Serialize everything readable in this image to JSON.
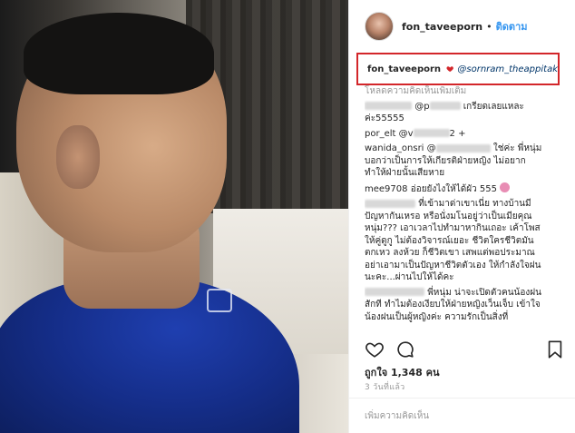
{
  "post": {
    "username": "fon_taveeporn",
    "dot": "•",
    "follow_label": "ติดตาม",
    "caption_mention": "@sornram_theappitak",
    "view_more_comments": "โหลดความคิดเห็นเพิ่มเติม",
    "comments": [
      {
        "handle_shown": "@p",
        "text": "เกรียดเลยแหละ",
        "text2": "ค่ะ55555"
      },
      {
        "handle_shown": "por_elt",
        "text": "@v",
        "text2": "2 +"
      },
      {
        "handle_shown": "wanida_onsri",
        "text": "@",
        "text2": "ใช่ค่ะ พี่หนุ่ม",
        "text3": "บอกว่าเป็นการให้เกียรติฝ่ายหญิง ไม่อยาก",
        "text4": "ทำให้ฝ่ายนั้นเสียหาย"
      },
      {
        "handle_shown": "mee9708",
        "text": "อ่อยยังไงให้ได้ผัว 555"
      },
      {
        "handle_shown": "malikal2443",
        "text": "ที่เข้ามาด่าเขาเนี่ย ทางบ้านมี",
        "text2": "ปัญหากันเหรอ หรือนั่งมโนอยู่ว่าเป็นเมียคุณ",
        "text3": "หนุ่ม??? เอาเวลาไปทำมาหากินเถอะ เค้าโพส",
        "text4": "ให้คู่ดูกู ไม่ต้องวิจารณ์เยอะ ชีวิตใครชีวิตมัน",
        "text5": "ตกเหว ลงห้วย ก็ชีวิตเขา เสพแต่พอประมาณ",
        "text6": "อย่าเอามาเป็นปัญหาชีวิตตัวเอง ให้กำลังใจฝน",
        "text7": "นะคะ...ผ่านไปให้ได้คะ"
      },
      {
        "handle_shown": "",
        "text": "พี่หนุ่ม น่าจะเปิดตัวคนน้องฝน",
        "text2": "สักที ทำไมต้องเงียบให้ฝ่ายหญิงเว็นเจ็บ เข้าใจ",
        "text3": "น้องฝนเป็นผู้หญิงค่ะ ความรักเป็นสิ่งที่"
      }
    ],
    "likes_text": "ถูกใจ 1,348 คน",
    "time_text": "3 วันที่แล้ว",
    "add_comment_placeholder": "เพิ่มความคิดเห็น"
  },
  "icons": {
    "heart_color": "#d3262a",
    "highlight_color": "#d3262a",
    "link_color": "#3897f0"
  }
}
